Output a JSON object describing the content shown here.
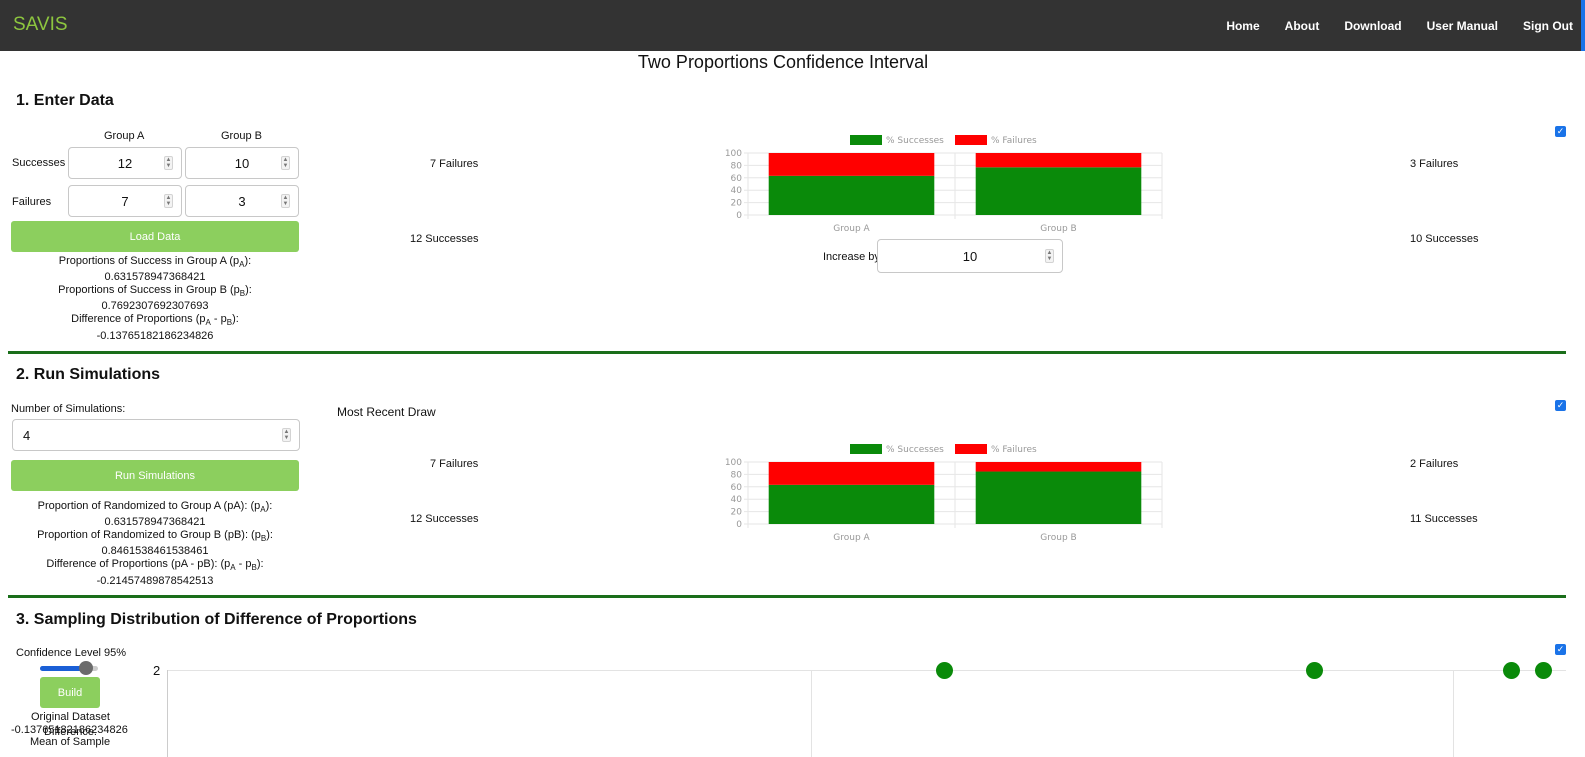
{
  "app": {
    "brand": "SAVIS"
  },
  "nav": [
    "Home",
    "About",
    "Download",
    "User Manual",
    "Sign Out"
  ],
  "page_title": "Two Proportions Confidence Interval",
  "section1": {
    "title": "1. Enter Data",
    "group_a_label": "Group A",
    "group_b_label": "Group B",
    "successes_label": "Successes",
    "failures_label": "Failures",
    "successes_a": "12",
    "successes_b": "10",
    "failures_a": "7",
    "failures_b": "3",
    "load_button": "Load Data",
    "prop_a_label": "Proportions of Success in Group A (p",
    "prop_a_sub": "A",
    "prop_a_value": "0.631578947368421",
    "prop_b_label": "Proportions of Success in Group B (p",
    "prop_b_sub": "B",
    "prop_b_value": "0.7692307692307693",
    "diff_label_1": "Difference of Proportions (p",
    "diff_sub_a": "A",
    "diff_mid": " - p",
    "diff_sub_b": "B",
    "diff_value": "-0.13765182186234826",
    "left_failures": "7 Failures",
    "left_successes": "12 Successes",
    "right_failures": "3 Failures",
    "right_successes": "10 Successes",
    "increase_label": "Increase by",
    "increase_value": "10"
  },
  "section2": {
    "title": "2. Run Simulations",
    "num_label": "Number of Simulations:",
    "num_value": "4",
    "run_button": "Run Simulations",
    "most_recent": "Most Recent Draw",
    "rand_a_label": "Proportion of Randomized to Group A (pA): (p",
    "rand_a_sub": "A",
    "rand_a_value": "0.631578947368421",
    "rand_b_label": "Proportion of Randomized to Group B (pB): (p",
    "rand_b_sub": "B",
    "rand_b_value": "0.8461538461538461",
    "diff_label": "Difference of Proportions (pA - pB): (p",
    "diff_sub_a": "A",
    "diff_mid": " - p",
    "diff_sub_b": "B",
    "diff_value": "-0.21457489878542513",
    "left_failures": "7 Failures",
    "left_successes": "12 Successes",
    "right_failures": "2 Failures",
    "right_successes": "11 Successes"
  },
  "section3": {
    "title": "3. Sampling Distribution of Difference of Proportions",
    "confidence_label": "Confidence Level 95%",
    "confidence_value": 0.95,
    "build_button": "Build",
    "original_dataset": "Original Dataset",
    "original_value": "-0.13765182186234826",
    "difference_label": "Difference:",
    "mean_label": "Mean of Sample",
    "y_tick": "2"
  },
  "legend": {
    "successes": "% Successes",
    "failures": "% Failures"
  },
  "colors": {
    "success": "#0a8a0a",
    "failure": "#ff0000",
    "nav_bg": "#333333",
    "brand": "#8dc63f",
    "button": "#8ccf5e",
    "divider": "#1a6e1a"
  },
  "chart_data": [
    {
      "type": "bar",
      "stacked": true,
      "categories": [
        "Group A",
        "Group B"
      ],
      "series": [
        {
          "name": "% Successes",
          "values": [
            63.16,
            76.92
          ]
        },
        {
          "name": "% Failures",
          "values": [
            36.84,
            23.08
          ]
        }
      ],
      "ylim": [
        0,
        100
      ],
      "yticks": [
        "0",
        "20",
        "40",
        "60",
        "80",
        "100"
      ],
      "legend": "top"
    },
    {
      "type": "bar",
      "stacked": true,
      "categories": [
        "Group A",
        "Group B"
      ],
      "series": [
        {
          "name": "% Successes",
          "values": [
            63.16,
            84.62
          ]
        },
        {
          "name": "% Failures",
          "values": [
            36.84,
            15.38
          ]
        }
      ],
      "ylim": [
        0,
        100
      ],
      "yticks": [
        "0",
        "20",
        "40",
        "60",
        "80",
        "100"
      ],
      "legend": "top"
    }
  ]
}
